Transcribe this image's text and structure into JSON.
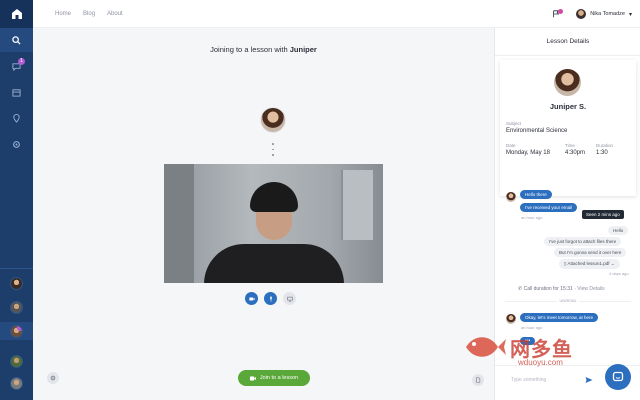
{
  "nav": {
    "links": [
      "Home",
      "Blog",
      "About"
    ]
  },
  "user": {
    "name": "Nika Tomadze"
  },
  "rail": {
    "messages_badge": "1"
  },
  "main": {
    "joining_prefix": "Joining to a lesson with",
    "joining_name": "Juniper",
    "join_button": "Join to a lesson"
  },
  "panel": {
    "title": "Lesson Details",
    "tutor_name": "Juniper S.",
    "subject_label": "Subject",
    "subject_value": "Environmental Science",
    "date_label": "Date",
    "date_value": "Monday, May 18",
    "time_label": "Time",
    "time_value": "4:30pm",
    "duration_label": "Duration",
    "duration_value": "1:30"
  },
  "chat": {
    "msg1": "Hello there",
    "msg2": "I've received your email",
    "msg2_time": "an hour ago",
    "tooltip": "Seen 2 mins ago",
    "out1": "Hello",
    "out2": "I've just forgot to attach files there",
    "out3": "But I'm gonna send it over here",
    "attach_label": "Attached",
    "attach_file": "lesson1.pdf",
    "out_time": "4 days ago",
    "call_text": "Call duration for 15:31",
    "call_link": "View Details",
    "unread": "UNREAD",
    "msg3": "Okay, let's meet tomorrow, at here",
    "msg3_time": "an hour ago",
    "typing": "•••",
    "input_placeholder": "Type something"
  },
  "watermark": {
    "cn": "网多鱼",
    "domain": "wduoyu.com"
  },
  "colors": {
    "rail": "#1d3d6b",
    "accent": "#2c6fbf",
    "join": "#5ba83a",
    "badge": "#b15ad1"
  }
}
